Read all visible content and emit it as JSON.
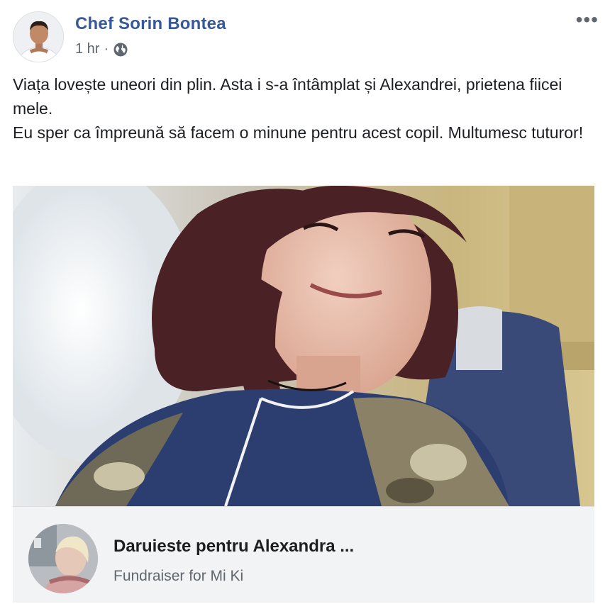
{
  "post": {
    "author": "Chef Sorin Bontea",
    "time": "1 hr",
    "separator": "·",
    "privacy_icon": "globe-icon",
    "more_label": "•••",
    "text_lines": [
      "Viața lovește uneori din plin. Asta i s-a întâmplat și Alexandrei, prietena fiicei mele.",
      "Eu sper ca împreună să facem o minune pentru acest copil. Multumesc tuturor!"
    ]
  },
  "fundraiser": {
    "title": "Daruieste pentru Alexandra ...",
    "subtitle": "Fundraiser for Mi Ki"
  },
  "colors": {
    "author_link": "#385898",
    "secondary_text": "#606770",
    "card_bg": "#f2f3f5"
  }
}
